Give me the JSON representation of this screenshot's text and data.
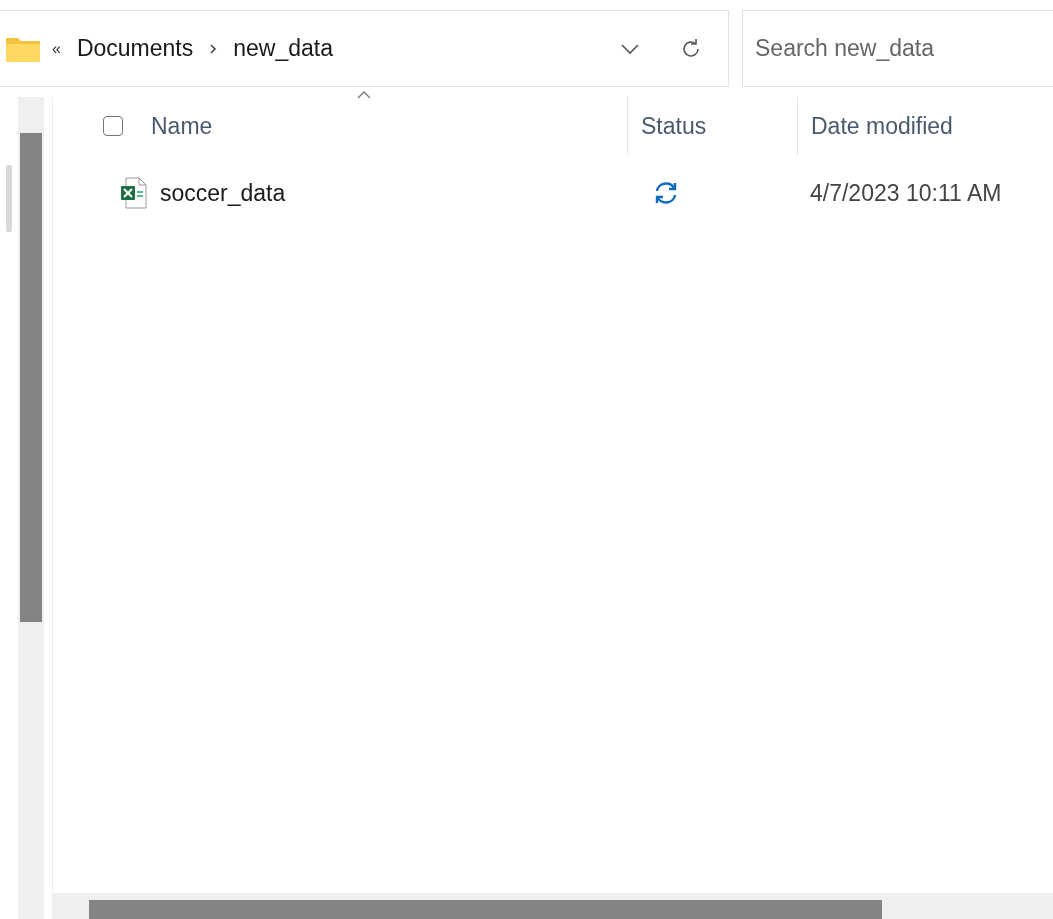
{
  "address_bar": {
    "overflow": "«",
    "crumbs": [
      "Documents",
      "new_data"
    ]
  },
  "search": {
    "placeholder": "Search new_data"
  },
  "header": {
    "select_all_checked": false,
    "columns": [
      {
        "label": "Name",
        "sorted": true
      },
      {
        "label": "Status",
        "sorted": false
      },
      {
        "label": "Date modified",
        "sorted": false
      }
    ]
  },
  "rows": [
    {
      "name": "soccer_data",
      "kind": "spreadsheet",
      "status": {
        "kind": "syncing"
      },
      "date_modified": "4/7/2023 10:11 AM",
      "selected": false
    }
  ]
}
